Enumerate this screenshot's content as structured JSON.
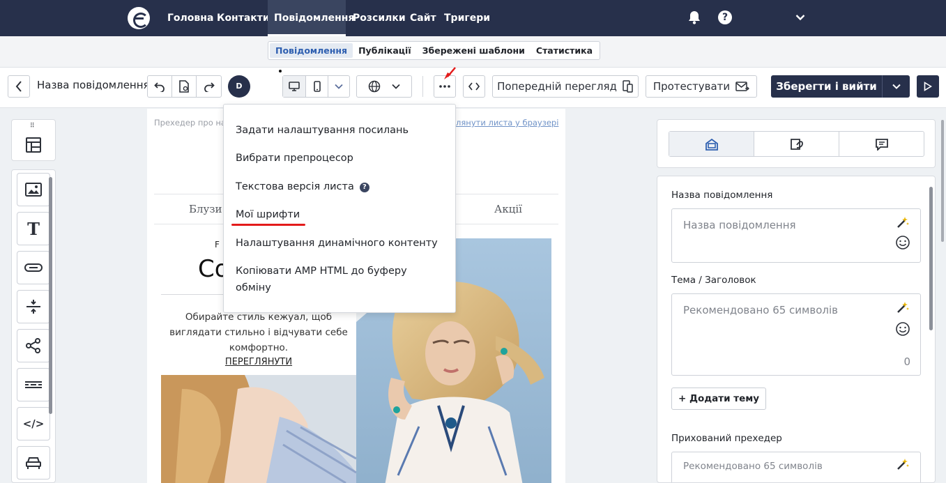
{
  "nav": {
    "items": [
      "Головна",
      "Контакти",
      "Повідомлення",
      "Розсилки",
      "Сайт",
      "Тригери"
    ],
    "active_index": 2
  },
  "subnav": {
    "items": [
      "Повідомлення",
      "Публікації",
      "Збережені шаблони",
      "Статистика"
    ],
    "active_index": 0
  },
  "toolbar": {
    "message_name": "Назва повідомлення",
    "avatar_initial": "D",
    "preview_label": "Попередній перегляд",
    "test_label": "Протестувати",
    "save_label": "Зберегти і вийти"
  },
  "canvas": {
    "preheader": "Прехедер про най",
    "view_link": "глянути листа у браузері",
    "menu_left": "Блузи",
    "menu_right": "Акції",
    "brand_small": "F A",
    "headline": "Co",
    "body": "Обирайте стиль кежуал, щоб виглядати стильно і відчувати себе комфортно.",
    "cta": "ПЕРЕГЛЯНУТИ"
  },
  "dropdown": {
    "items": [
      "Задати налаштування посилань",
      "Вибрати препроцесор",
      "Текстова версія листа",
      "Мої шрифти",
      "Налаштування динамічного контенту",
      "Копіювати AMP HTML до буферу",
      "обміну"
    ],
    "help_icon": "?"
  },
  "right_panel": {
    "name_label": "Назва повідомлення",
    "name_placeholder": "Назва повідомлення",
    "subject_label": "Тема / Заголовок",
    "subject_placeholder": "Рекомендовано 65 символів",
    "subject_counter": "0",
    "add_subject": "+ Додати тему",
    "preheader_label": "Прихований прехедер",
    "preheader_placeholder": "Рекомендовано 65 символів"
  },
  "colors": {
    "nav_bg": "#27304b",
    "accent_blue": "#2e5fb0",
    "annotation_red": "#e31b1b",
    "magic_wand": "#e8b400"
  },
  "icons": [
    "logo-icon",
    "bell-icon",
    "help-icon",
    "chevron-down-icon",
    "back-icon",
    "undo-icon",
    "file-icon",
    "redo-icon",
    "desktop-icon",
    "mobile-icon",
    "globe-icon",
    "more-icon",
    "code-icon",
    "preview-icon",
    "mail-icon",
    "play-icon",
    "layout-icon",
    "image-icon",
    "text-icon",
    "button-icon",
    "spacer-icon",
    "share-icon",
    "divider-icon",
    "html-icon",
    "menu-icon",
    "magic-wand-icon",
    "emoji-icon"
  ]
}
